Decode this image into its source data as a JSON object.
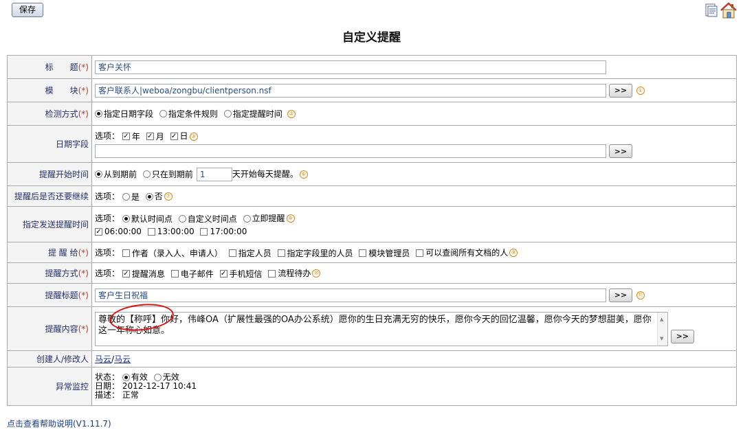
{
  "toolbar": {
    "save_label": "保存"
  },
  "page_title": "自定义提醒",
  "rows": {
    "title": {
      "label": "标　　题",
      "req": "(*)",
      "value": "客户关怀"
    },
    "module": {
      "label": "模　　块",
      "req": "(*)",
      "value": "客户联系人|weboa/zongbu/clientperson.nsf",
      "btn": ">>",
      "num": "①"
    },
    "detect": {
      "label": "检测方式",
      "req": "(*)",
      "options": [
        "指定日期字段",
        "指定条件规则",
        "指定提醒时间"
      ],
      "selected": 0,
      "num": "②"
    },
    "date_field": {
      "label": "日期字段",
      "prefix": "选项：",
      "checks": [
        "年",
        "月",
        "日"
      ],
      "num": "③",
      "value": "",
      "btn": ">>"
    },
    "start_time": {
      "label": "提醒开始时间",
      "opt1": "从到期前",
      "opt2": "只在到期前",
      "days": "1",
      "suffix": "天开始每天提醒。",
      "num": "⑥"
    },
    "continue": {
      "label": "提醒后是否还要继续",
      "prefix": "选项：",
      "options": [
        "是",
        "否"
      ],
      "selected": 1,
      "num": "⑦"
    },
    "send_time": {
      "label": "指定发送提醒时间",
      "prefix": "选项：",
      "options": [
        "默认时间点",
        "自定义时间点",
        "立即提醒"
      ],
      "selected": 0,
      "num": "⑧",
      "times": [
        "06:00:00",
        "13:00:00",
        "17:00:00"
      ],
      "times_checked": [
        true,
        false,
        false
      ]
    },
    "remind_to": {
      "label": "提 醒 给",
      "req": "(*)",
      "prefix": "选项：",
      "options": [
        "作者（录入人、申请人）",
        "指定人员",
        "指定字段里的人员",
        "模块管理员",
        "可以查阅所有文档的人"
      ],
      "num": "⑨"
    },
    "method": {
      "label": "提醒方式",
      "req": "(*)",
      "prefix": "选项：",
      "options": [
        "提醒消息",
        "电子邮件",
        "手机短信",
        "流程待办"
      ],
      "checked": [
        true,
        false,
        true,
        false
      ],
      "num": "⑩"
    },
    "remind_title": {
      "label": "提醒标题",
      "req": "(*)",
      "value": "客户生日祝福",
      "btn": ">>",
      "num": "⑪"
    },
    "content": {
      "label": "提醒内容",
      "req": "(*)",
      "value": "尊敬的【称呼】你好，伟峰OA（扩展性最强的OA办公系统）愿你的生日充满无穷的快乐，愿你今天的回忆温馨，愿你今天的梦想甜美，愿你这一年称心如意。",
      "btn": ">>"
    },
    "creator": {
      "label": "创建人/修改人",
      "creator": "马云",
      "sep": "/",
      "modifier": "马云"
    },
    "monitor": {
      "label": "异常监控",
      "status_label": "状态：",
      "options": [
        "有效",
        "无效"
      ],
      "selected": 0,
      "date_label": "日期：",
      "date": "2012-12-17 10:41",
      "desc_label": "描述：",
      "desc": "正常"
    }
  },
  "help_link": "点击查看帮助说明(V1.11.7)",
  "icons": [
    "document-icon",
    "home-icon",
    "scrollbar-up-icon",
    "scrollbar-down-icon"
  ],
  "colors": {
    "label_text": "#25316b",
    "required": "#c0392b",
    "number_badge": "#d48a1a",
    "highlight_circle": "#dd1111"
  }
}
